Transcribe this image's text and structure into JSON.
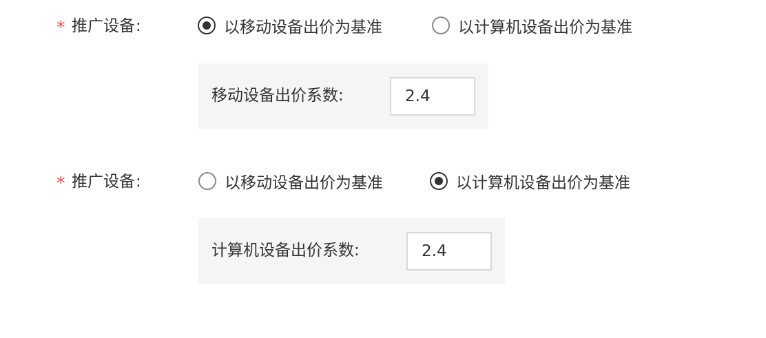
{
  "groups": [
    {
      "required_mark": "*",
      "label": "推广设备",
      "colon": ":",
      "options": [
        {
          "label": "以移动设备出价为基准",
          "checked": true
        },
        {
          "label": "以计算机设备出价为基准",
          "checked": false
        }
      ],
      "coefficient": {
        "label": "移动设备出价系数",
        "colon": ":",
        "value": "2.4"
      }
    },
    {
      "required_mark": "*",
      "label": "推广设备",
      "colon": ":",
      "options": [
        {
          "label": "以移动设备出价为基准",
          "checked": false
        },
        {
          "label": "以计算机设备出价为基准",
          "checked": true
        }
      ],
      "coefficient": {
        "label": "计算机设备出价系数",
        "colon": ":",
        "value": "2.4"
      }
    }
  ],
  "colors": {
    "required": "#f24b4b",
    "text": "#333333",
    "panel_bg": "#f5f5f5",
    "input_border": "#d9d9d9"
  }
}
